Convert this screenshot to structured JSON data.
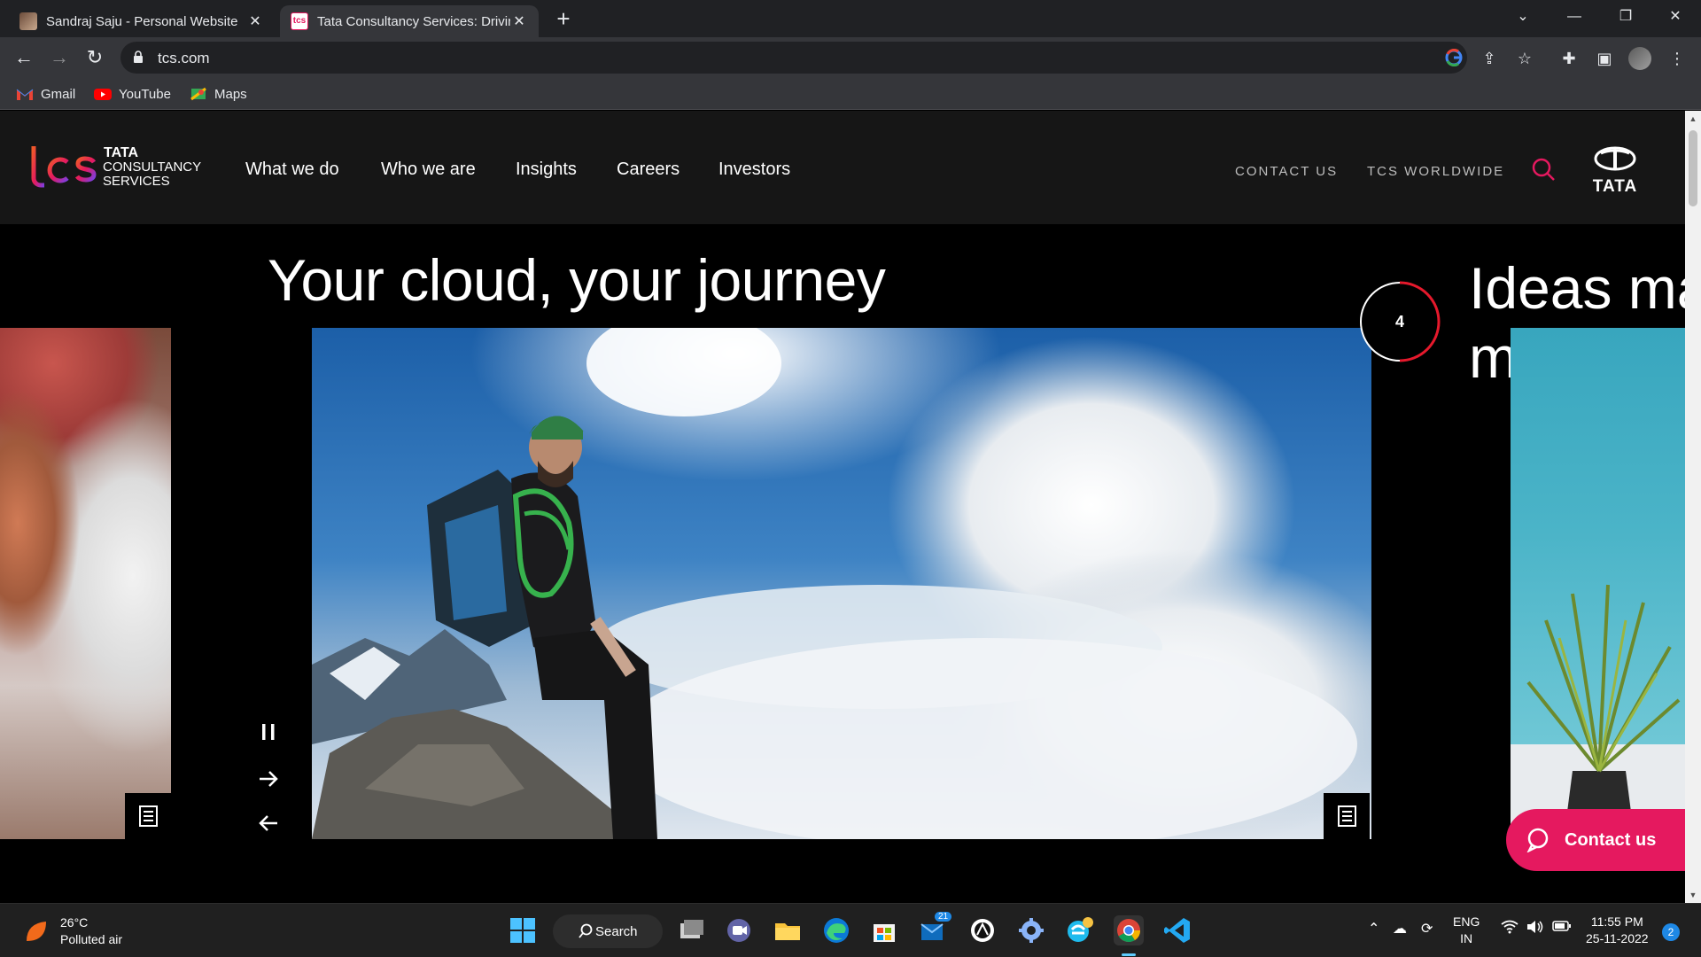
{
  "browser": {
    "tabs": [
      {
        "title": "Sandraj Saju - Personal Website",
        "active": false
      },
      {
        "title": "Tata Consultancy Services: Driving Building on belief",
        "active": true
      }
    ],
    "new_tab": "+",
    "url": "tcs.com",
    "bookmarks": [
      {
        "label": "Gmail",
        "icon": "gmail-icon"
      },
      {
        "label": "YouTube",
        "icon": "youtube-icon"
      },
      {
        "label": "Maps",
        "icon": "maps-icon"
      }
    ]
  },
  "site": {
    "logo": {
      "line1": "TATA",
      "line2": "CONSULTANCY",
      "line3": "SERVICES"
    },
    "nav": [
      "What we do",
      "Who we are",
      "Insights",
      "Careers",
      "Investors"
    ],
    "utility": {
      "contact": "CONTACT US",
      "worldwide": "TCS WORLDWIDE"
    },
    "tata_logo": "TATA",
    "hero": {
      "title": "Your cloud, your journey",
      "next_title_line1": "Ideas ma",
      "next_title_line2": "multiplie",
      "slide_counter": "4"
    },
    "controls": {
      "pause": "pause-icon",
      "next": "arrow-right-icon",
      "prev": "arrow-left-icon"
    },
    "contact_button": "Contact us",
    "colors": {
      "accent": "#e5195f",
      "header_bg": "#161616",
      "hero_bg": "#000000"
    }
  },
  "taskbar": {
    "weather_temp": "26°C",
    "weather_desc": "Polluted air",
    "search_label": "Search",
    "mail_badge": "21",
    "lang_line1": "ENG",
    "lang_line2": "IN",
    "time": "11:55 PM",
    "date": "25-11-2022",
    "notification_count": "2"
  }
}
